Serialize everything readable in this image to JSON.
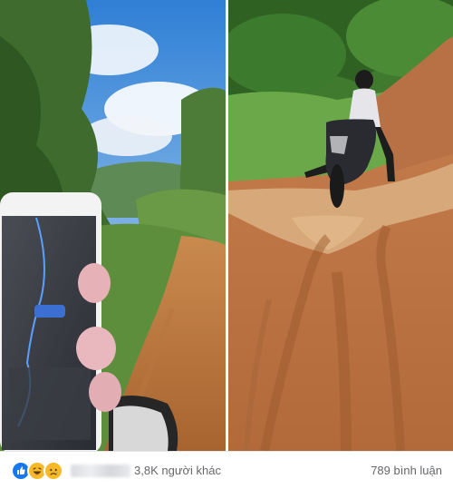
{
  "photos": {
    "left": {
      "icon": "photo-forest-trail-with-phone-map"
    },
    "right": {
      "icon": "photo-motorbike-in-muddy-road"
    }
  },
  "reactions": {
    "icons": [
      "like-icon",
      "haha-icon",
      "sad-icon"
    ],
    "colors": {
      "like": "#1877f2",
      "haha": "#f7b928",
      "sad": "#f7b928"
    },
    "others_text": "3,8K người khác",
    "comments_text": "789 bình luận"
  }
}
